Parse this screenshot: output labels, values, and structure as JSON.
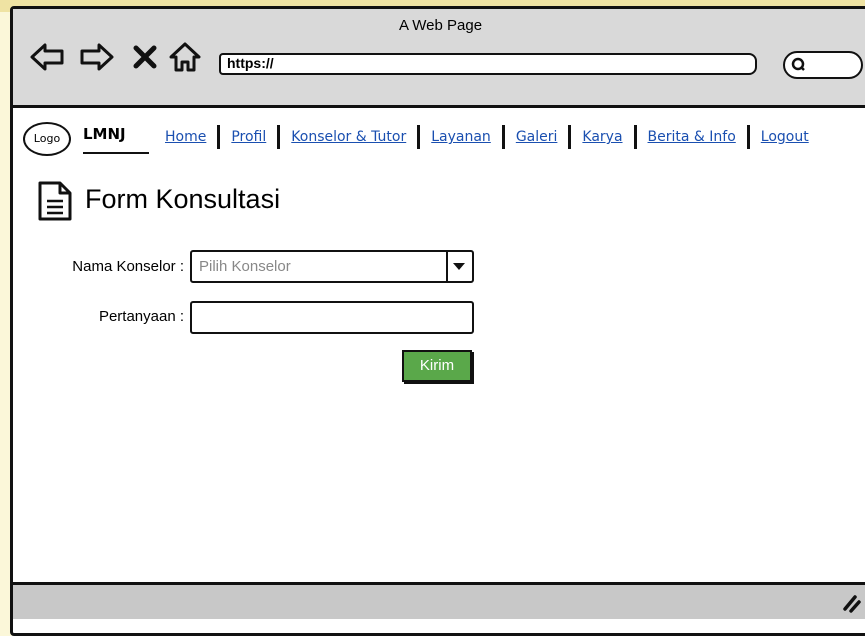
{
  "window": {
    "title": "A Web Page",
    "url": "https://"
  },
  "nav": {
    "logo": "Logo",
    "brand": "LMNJ",
    "items": [
      "Home",
      "Profil",
      "Konselor & Tutor",
      "Layanan",
      "Galeri",
      "Karya",
      "Berita & Info",
      "Logout"
    ]
  },
  "form": {
    "title": "Form Konsultasi",
    "konselor_label": "Nama Konselor :",
    "konselor_placeholder": "Pilih Konselor",
    "pertanyaan_label": "Pertanyaan :",
    "pertanyaan_value": "",
    "submit": "Kirim"
  },
  "colors": {
    "link": "#1a4fb0",
    "submit_bg": "#5aa84a",
    "chrome": "#d9d9d9"
  },
  "icons": [
    "back-arrow-icon",
    "forward-arrow-icon",
    "close-icon",
    "home-icon",
    "search-icon",
    "document-icon",
    "dropdown-arrow-icon",
    "resize-grip-icon"
  ]
}
